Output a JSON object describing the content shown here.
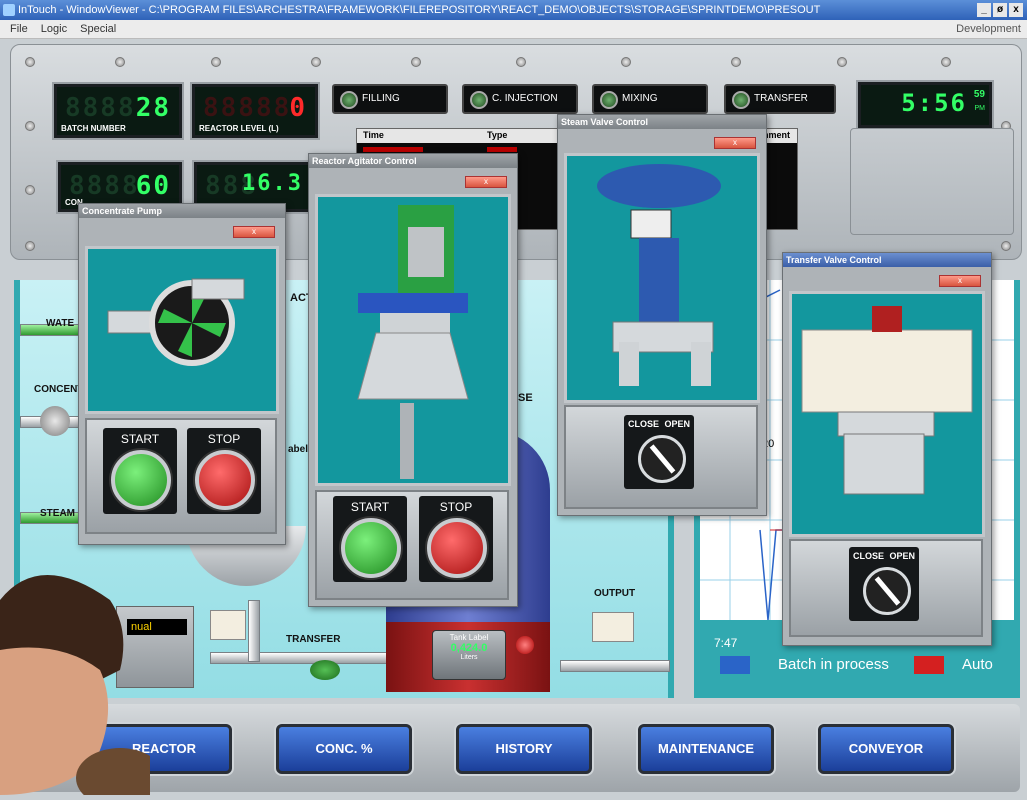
{
  "window": {
    "title": "InTouch - WindowViewer - C:\\PROGRAM FILES\\ARCHESTRA\\FRAMEWORK\\FILEREPOSITORY\\REACT_DEMO\\OBJECTS\\STORAGE\\SPRINTDEMO\\PRESOUT",
    "controls": [
      "_",
      "ø",
      "x"
    ]
  },
  "menu": {
    "items": [
      "File",
      "Logic",
      "Special"
    ],
    "right": "Development"
  },
  "counters": {
    "batch_number": {
      "value": "28",
      "caption": "BATCH NUMBER"
    },
    "reactor_level": {
      "value": "0",
      "caption": "REACTOR LEVEL (L)"
    },
    "concentrate": {
      "value": "60",
      "caption": "CON"
    },
    "fourth": {
      "value": "16.3",
      "caption": ""
    },
    "clock": {
      "value": "5:56",
      "seconds": "59",
      "ampm": "PM"
    }
  },
  "status_buttons": [
    {
      "label": "FILLING"
    },
    {
      "label": "C. INJECTION"
    },
    {
      "label": "MIXING"
    },
    {
      "label": "TRANSFER"
    }
  ],
  "alarm_table": {
    "columns": [
      "Time",
      "Type",
      "omment"
    ],
    "row_colors": [
      "#b00",
      "#b00"
    ]
  },
  "process": {
    "labels": {
      "water": "WATE",
      "concentrate": "CONCENT",
      "steam": "STEAM",
      "transfer": "TRANSFER",
      "output": "OUTPUT",
      "tank_title": "Tank Label",
      "tank_value": "0,424.0",
      "tank_units": "Liters",
      "manual": "nual",
      "act": "ACT",
      "se": "SE",
      "label": "abel"
    }
  },
  "trend": {
    "time_label": "7:47",
    "tick_20": "20",
    "legend": [
      {
        "label": "Batch in process",
        "color": "#2a64c8"
      },
      {
        "label": "Auto",
        "color": "#d42020"
      }
    ]
  },
  "dialogs": {
    "concentrate_pump": {
      "title": "Concentrate Pump",
      "start": "START",
      "stop": "STOP"
    },
    "reactor_agitator": {
      "title": "Reactor Agitator Control",
      "start": "START",
      "stop": "STOP"
    },
    "steam_valve": {
      "title": "Steam Valve Control",
      "close": "CLOSE",
      "open": "OPEN"
    },
    "transfer_valve": {
      "title": "Transfer Valve Control",
      "close": "CLOSE",
      "open": "OPEN"
    }
  },
  "nav": [
    {
      "label": "REACTOR"
    },
    {
      "label": "CONC. %"
    },
    {
      "label": "HISTORY"
    },
    {
      "label": "MAINTENANCE"
    },
    {
      "label": "CONVEYOR"
    }
  ],
  "colors": {
    "accent_blue": "#2a64c8",
    "alarm_red": "#d42020",
    "lcd_green": "#33ff66",
    "lcd_red": "#ff2a2a"
  }
}
